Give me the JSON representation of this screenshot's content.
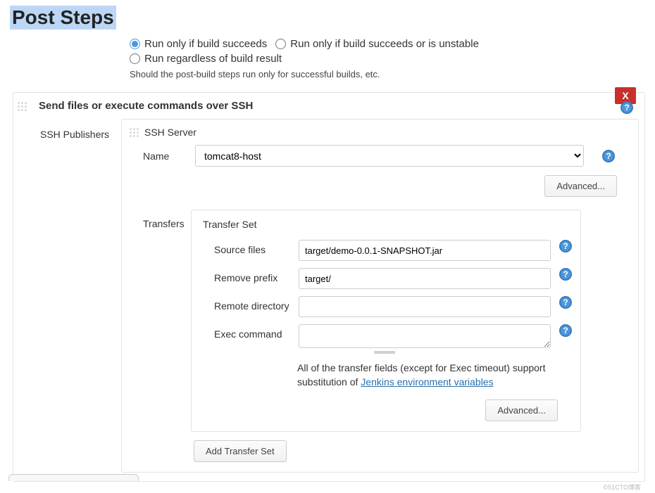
{
  "page": {
    "title": "Post Steps"
  },
  "run_options": {
    "opt1": "Run only if build succeeds",
    "opt2": "Run only if build succeeds or is unstable",
    "opt3": "Run regardless of build result",
    "hint": "Should the post-build steps run only for successful builds, etc."
  },
  "section": {
    "title": "Send files or execute commands over SSH",
    "remove_label": "X",
    "publishers_label": "SSH Publishers",
    "server_label": "SSH Server",
    "name_label": "Name",
    "name_value": "tomcat8-host",
    "advanced_label": "Advanced...",
    "transfers_label": "Transfers",
    "transfer_set_label": "Transfer Set",
    "source_files_label": "Source files",
    "source_files_value": "target/demo-0.0.1-SNAPSHOT.jar",
    "remove_prefix_label": "Remove prefix",
    "remove_prefix_value": "target/",
    "remote_dir_label": "Remote directory",
    "remote_dir_value": "",
    "exec_cmd_label": "Exec command",
    "exec_cmd_value": "",
    "note_prefix": "All of the transfer fields (except for Exec timeout) support substitution of ",
    "note_link": "Jenkins environment variables",
    "add_transfer_label": "Add Transfer Set"
  },
  "help_glyph": "?",
  "watermark": "©51CTO博客"
}
